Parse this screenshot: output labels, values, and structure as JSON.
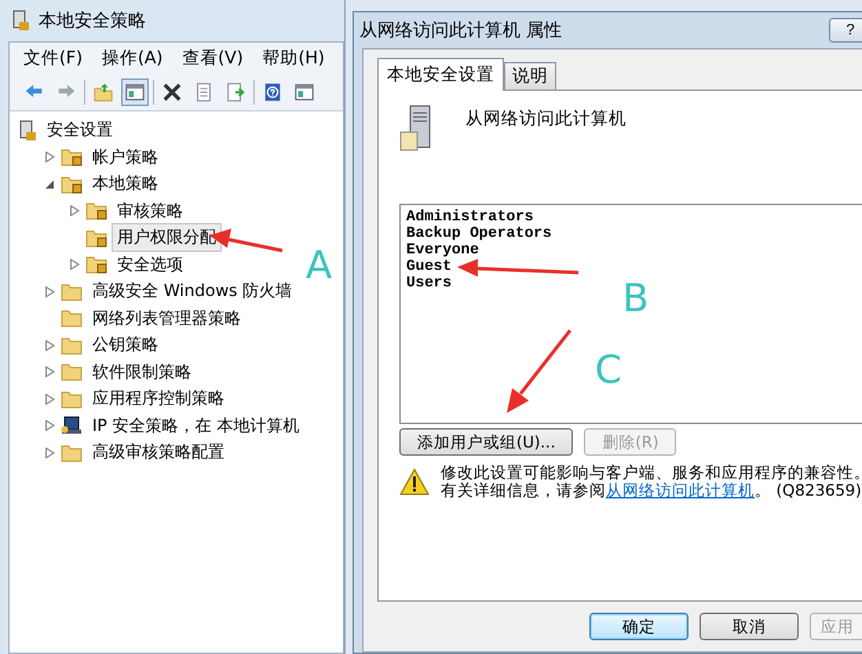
{
  "main_window": {
    "title": "本地安全策略",
    "menu": [
      "文件(F)",
      "操作(A)",
      "查看(V)",
      "帮助(H)"
    ],
    "toolbar": [
      {
        "kind": "back"
      },
      {
        "kind": "forward"
      },
      {
        "kind": "sep"
      },
      {
        "kind": "up"
      },
      {
        "kind": "pane",
        "selected": true
      },
      {
        "kind": "sep"
      },
      {
        "kind": "delete"
      },
      {
        "kind": "properties"
      },
      {
        "kind": "export"
      },
      {
        "kind": "sep"
      },
      {
        "kind": "help"
      },
      {
        "kind": "pane",
        "selected": false
      }
    ],
    "tree": {
      "label": "安全设置",
      "children": [
        {
          "label": "帐户策略",
          "expandable": true,
          "expanded": false,
          "kind": "lock-folder",
          "selected": false
        },
        {
          "label": "本地策略",
          "expandable": true,
          "expanded": true,
          "kind": "lock-folder",
          "selected": false,
          "children": [
            {
              "label": "审核策略",
              "expandable": true,
              "expanded": false,
              "kind": "lock-folder",
              "selected": false
            },
            {
              "label": "用户权限分配",
              "expandable": false,
              "expanded": false,
              "kind": "lock-folder",
              "selected": true
            },
            {
              "label": "安全选项",
              "expandable": true,
              "expanded": false,
              "kind": "lock-folder",
              "selected": false
            }
          ]
        },
        {
          "label": "高级安全 Windows 防火墙",
          "expandable": true,
          "expanded": false,
          "kind": "folder",
          "selected": false
        },
        {
          "label": "网络列表管理器策略",
          "expandable": false,
          "expanded": false,
          "kind": "folder",
          "selected": false
        },
        {
          "label": "公钥策略",
          "expandable": true,
          "expanded": false,
          "kind": "folder",
          "selected": false
        },
        {
          "label": "软件限制策略",
          "expandable": true,
          "expanded": false,
          "kind": "folder",
          "selected": false
        },
        {
          "label": "应用程序控制策略",
          "expandable": true,
          "expanded": false,
          "kind": "folder",
          "selected": false
        },
        {
          "label": "IP 安全策略，在 本地计算机",
          "expandable": true,
          "expanded": false,
          "kind": "ip",
          "selected": false
        },
        {
          "label": "高级审核策略配置",
          "expandable": true,
          "expanded": false,
          "kind": "folder",
          "selected": false
        }
      ]
    }
  },
  "dialog": {
    "title": "从网络访问此计算机 属性",
    "help_button": "?",
    "tabs": [
      {
        "label": "本地安全设置",
        "selected": true
      },
      {
        "label": "说明",
        "selected": false
      }
    ],
    "policy_name": "从网络访问此计算机",
    "accounts": [
      "Administrators",
      "Backup Operators",
      "Everyone",
      "Guest",
      "Users"
    ],
    "buttons": [
      {
        "label": "添加用户或组(U)...",
        "disabled": false
      },
      {
        "label": "删除(R)",
        "disabled": true
      }
    ],
    "warning": {
      "line1": "修改此设置可能影响与客户端、服务和应用程序的兼容性。",
      "line2": "有关详细信息，请参阅",
      "link": "从网络访问此计算机",
      "line2_end": "。 (Q823659)"
    },
    "footer_buttons": [
      {
        "label": "确定",
        "default": true,
        "disabled": false
      },
      {
        "label": "取消",
        "default": false,
        "disabled": false
      },
      {
        "label": "应用",
        "default": false,
        "disabled": true
      }
    ]
  },
  "annotations": [
    {
      "label": "A"
    },
    {
      "label": "B"
    },
    {
      "label": "C"
    }
  ]
}
